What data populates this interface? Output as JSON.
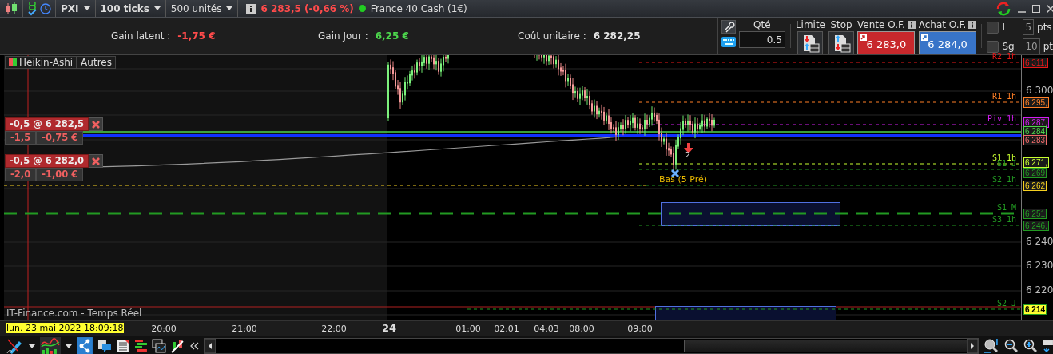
{
  "toolbar": {
    "symbol": "PXI",
    "period": "100 ticks",
    "quantity": "500 unités",
    "price": "6 283,5 (-0,66 %)",
    "connected": true,
    "instrument": "France 40 Cash (1€)"
  },
  "summary": [
    {
      "label": "Gain latent :",
      "value": "-1,75 €",
      "color": "#ff4b4b"
    },
    {
      "label": "Gain Jour :",
      "value": "6,25 €",
      "color": "#4cd64c"
    },
    {
      "label": "Coût unitaire :",
      "value": "6 282,25",
      "color": "#e6e6e6"
    }
  ],
  "order_panel": {
    "qty_label": "Qté",
    "qty": "0.5",
    "limit_label": "Limite",
    "stop_label": "Stop",
    "sell_label": "Vente O.F.",
    "sell_price": "6 283,0",
    "buy_label": "Achat O.F.",
    "buy_price": "6 284,0",
    "options": [
      {
        "label": "L",
        "checked": false,
        "points": "5",
        "unit": "pts"
      },
      {
        "label": "Sg",
        "checked": false,
        "points": "10",
        "unit": "pt"
      }
    ]
  },
  "chart": {
    "tabs": [
      "Heikin-Ashi",
      "Autres"
    ],
    "source": "IT-Finance.com - Temps Réel",
    "price_ticks": [
      "6 300",
      "6 240",
      "6 230",
      "6 220"
    ],
    "price_lines": [
      {
        "label": "R2 1h",
        "badge": "6 311,",
        "color": "#e81818",
        "kind": "dashed",
        "highlighted": false
      },
      {
        "label": "R1 1h",
        "badge": "6 295,",
        "color": "#ff7f27",
        "kind": "dashed",
        "highlighted": false
      },
      {
        "label": "Piv 1h",
        "badge": "6 287,",
        "color": "#d21ef0",
        "kind": "dashed",
        "highlighted": false
      },
      {
        "badge": "6 284",
        "color": "#4cd44c",
        "kind": "solid",
        "highlighted": false
      },
      {
        "badge": "6 283",
        "color": "#f06a6a",
        "kind": "current",
        "highlighted": false
      },
      {
        "label": "S1 1h",
        "badge": "6 271,",
        "color": "#c8ff30",
        "kind": "dashed",
        "highlighted": false
      },
      {
        "label": "S1 J",
        "badge": "6 269",
        "color": "#229a22",
        "kind": "dashed",
        "highlighted": false
      },
      {
        "badge": "6 262",
        "color": "#f5d020",
        "kind": "dashed",
        "highlighted": false
      },
      {
        "label": "S2 1h",
        "color": "#229a22",
        "kind": "dashed"
      },
      {
        "label": "S1 M",
        "badge": "6 251",
        "color": "#229a22",
        "kind": "long-dash",
        "highlighted": false
      },
      {
        "label": "S3 1h",
        "badge": "6 246,",
        "color": "#229a22",
        "kind": "dashed",
        "highlighted": false
      },
      {
        "label": "S2 J",
        "badge": "6 214",
        "color": "#229a22",
        "kind": "dashed",
        "highlighted": true
      }
    ],
    "orders": [
      {
        "order": "-0,5 @ 6 282,5",
        "qty": "-1,5",
        "pnl": "-0,75 €"
      },
      {
        "order": "-0,5 @ 6 282,0",
        "qty": "-2,0",
        "pnl": "-1,00 €"
      }
    ],
    "low_label": "Bas (5 Pré)",
    "signal_count": "2",
    "cursor_date": "lun. 23 mai 2022 18:09:18",
    "time_ticks": [
      {
        "label": "20:00",
        "major": false
      },
      {
        "label": "21:00",
        "major": false
      },
      {
        "label": "22:00",
        "major": false
      },
      {
        "label": "24",
        "major": true
      },
      {
        "label": "01:00",
        "major": false
      },
      {
        "label": "02:01",
        "major": false
      },
      {
        "label": "04:03",
        "major": false
      },
      {
        "label": "08:00",
        "major": false
      },
      {
        "label": "09:00",
        "major": false
      }
    ]
  }
}
